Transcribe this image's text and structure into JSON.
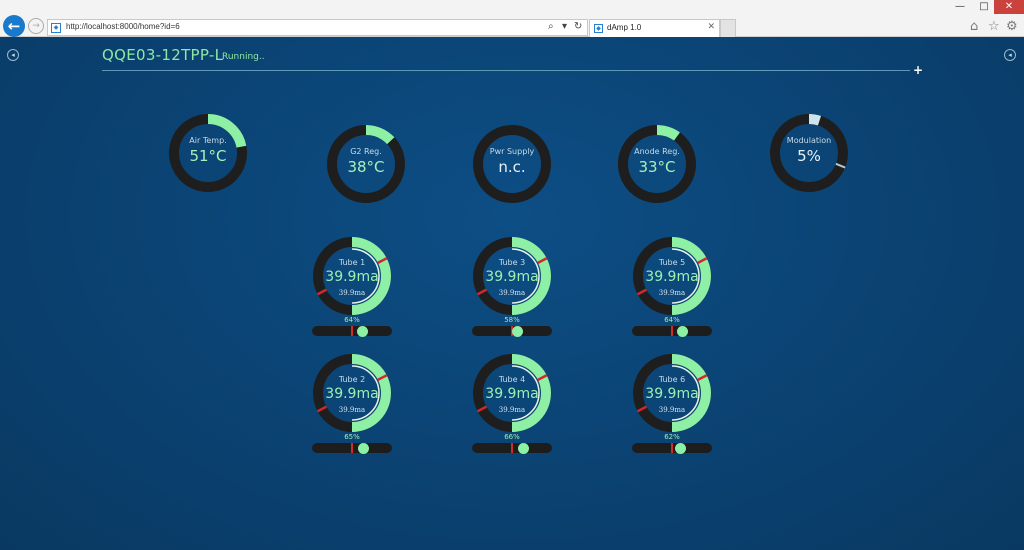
{
  "browser": {
    "url": "http://localhost:8000/home?id=6",
    "tab_title": "dAmp 1.0",
    "window_min": "—",
    "window_max": "□",
    "window_close": "✕",
    "back_glyph": "←",
    "fwd_glyph": "→",
    "search_glyph": "⌕",
    "dropdown_glyph": "▾",
    "refresh_glyph": "↻",
    "tab_close_glyph": "✕",
    "home_glyph": "⌂",
    "star_glyph": "☆",
    "gear_glyph": "⚙",
    "site_glyph": "◆",
    "icons": [
      "back-icon",
      "forward-icon",
      "search-icon",
      "dropdown-icon",
      "refresh-icon",
      "close-icon",
      "home-icon",
      "star-icon",
      "gear-icon"
    ]
  },
  "app": {
    "device": "QQE03-12TPP-L",
    "status": "Running..",
    "plus_glyph": "+",
    "side_glyph": "◂",
    "colors": {
      "accent": "#8ef0a5",
      "ring_bg": "#1e1e1e",
      "warning": "#d02a2a",
      "modulation": "#cde4ef",
      "background": "#0b3d66"
    }
  },
  "gauges": [
    {
      "label": "Air Temp.",
      "value": "51°C",
      "fraction": 0.22,
      "color": "#8ef0a5"
    },
    {
      "label": "G2 Reg.",
      "value": "38°C",
      "fraction": 0.13,
      "color": "#8ef0a5"
    },
    {
      "label": "Pwr Supply",
      "value": "n.c.",
      "fraction": 0,
      "color": "#8ef0a5"
    },
    {
      "label": "Anode Reg.",
      "value": "33°C",
      "fraction": 0.1,
      "color": "#8ef0a5"
    },
    {
      "label": "Modulation",
      "value": "5%",
      "fraction": 0.05,
      "color": "#cde4ef"
    }
  ],
  "tubes": [
    {
      "label": "Tube 1",
      "value": "39.9ma",
      "sub": "39.9ma",
      "percent": "64%",
      "level": 0.64
    },
    {
      "label": "Tube 2",
      "value": "39.9ma",
      "sub": "39.9ma",
      "percent": "65%",
      "level": 0.65
    },
    {
      "label": "Tube 3",
      "value": "39.9ma",
      "sub": "39.9ma",
      "percent": "58%",
      "level": 0.58
    },
    {
      "label": "Tube 4",
      "value": "39.9ma",
      "sub": "39.9ma",
      "percent": "66%",
      "level": 0.66
    },
    {
      "label": "Tube 5",
      "value": "39.9ma",
      "sub": "39.9ma",
      "percent": "64%",
      "level": 0.64
    },
    {
      "label": "Tube 6",
      "value": "39.9ma",
      "sub": "39.9ma",
      "percent": "62%",
      "level": 0.62
    }
  ]
}
